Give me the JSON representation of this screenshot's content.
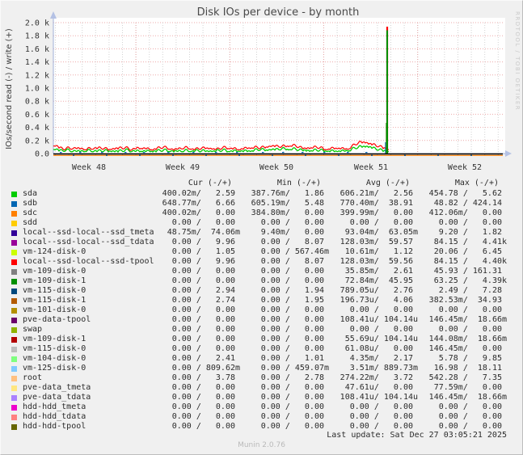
{
  "title": "Disk IOs per device - by month",
  "watermark": "RRDTOOL / TOBI OETIKER",
  "footer": {
    "last_update": "Last update: Sat Dec 27 03:05:21 2025",
    "munin_version": "Munin 2.0.76"
  },
  "legend": {
    "headers": [
      "Cur (-/+)",
      "Min (-/+)",
      "Avg (-/+)",
      "Max (-/+)"
    ]
  },
  "chart_data": {
    "type": "line",
    "title": "Disk IOs per device - by month",
    "ylabel": "IOs/second read (-) / write (+)",
    "xlabel": "",
    "grid": true,
    "legend_position": "bottom-table",
    "ylim": [
      0,
      2000
    ],
    "y_ticks": [
      "2.0 k",
      "1.8 k",
      "1.6 k",
      "1.4 k",
      "1.2 k",
      "1.0 k",
      "0.8 k",
      "0.6 k",
      "0.4 k",
      "0.2 k",
      "0.0"
    ],
    "x_ticks": [
      "Week 48",
      "Week 49",
      "Week 50",
      "Week 51",
      "Week 52"
    ],
    "visible_features": {
      "baseline_band": "all active devices fluctuate between 0 and ~80 write IOs/s across Weeks 48-51",
      "spike": {
        "x_label": "just after Week 51",
        "peak_write_ios": 1900,
        "colors_top_to_bottom": [
          "#FF0000",
          "#008F00"
        ]
      },
      "after_spike": "flat at ~0 until right edge (Week 52+)",
      "negative_read_line": "thin orange line just below zero across full width"
    },
    "series": [
      {
        "label": "sda",
        "color": "#00CC00",
        "cur": "400.02m/   2.59 ",
        "min": "387.76m/   1.86 ",
        "avg": "606.21m/   2.56 ",
        "max": "454.78 /   5.62 "
      },
      {
        "label": "sdb",
        "color": "#0066B3",
        "cur": "648.77m/   6.66 ",
        "min": "605.19m/   5.48 ",
        "avg": "770.40m/  38.91 ",
        "max": " 48.82 / 424.14 "
      },
      {
        "label": "sdc",
        "color": "#FF8000",
        "cur": "400.02m/   0.00 ",
        "min": "384.80m/   0.00 ",
        "avg": "399.99m/   0.00 ",
        "max": "412.06m/   0.00 "
      },
      {
        "label": "sdd",
        "color": "#FFCC00",
        "cur": "  0.00 /   0.00 ",
        "min": "  0.00 /   0.00 ",
        "avg": "  0.00 /   0.00 ",
        "max": "  0.00 /   0.00 "
      },
      {
        "label": "local--ssd-local--ssd_tmeta",
        "color": "#330099",
        "cur": " 48.75m/  74.06m",
        "min": "  9.40m/   0.00 ",
        "avg": " 93.04m/  63.05m",
        "max": "  9.20 /   1.82 "
      },
      {
        "label": "local--ssd-local--ssd_tdata",
        "color": "#990099",
        "cur": "  0.00 /   9.96 ",
        "min": "  0.00 /   8.07 ",
        "avg": "128.03m/  59.57 ",
        "max": " 84.15 /   4.41k"
      },
      {
        "label": "vm-124-disk-0",
        "color": "#CCFF00",
        "cur": "  0.00 /   1.05 ",
        "min": "  0.00 / 567.46m",
        "avg": " 10.61m/   1.12 ",
        "max": " 20.06 /   6.45 "
      },
      {
        "label": "local--ssd-local--ssd-tpool",
        "color": "#FF0000",
        "cur": "  0.00 /   9.96 ",
        "min": "  0.00 /   8.07 ",
        "avg": "128.03m/  59.56 ",
        "max": " 84.15 /   4.40k"
      },
      {
        "label": "vm-109-disk-0",
        "color": "#808080",
        "cur": "  0.00 /   0.00 ",
        "min": "  0.00 /   0.00 ",
        "avg": " 35.85m/   2.61 ",
        "max": " 45.93 / 161.31 "
      },
      {
        "label": "vm-109-disk-1",
        "color": "#008F00",
        "cur": "  0.00 /   0.00 ",
        "min": "  0.00 /   0.00 ",
        "avg": " 72.84m/  45.95 ",
        "max": " 63.25 /   4.39k"
      },
      {
        "label": "vm-115-disk-0",
        "color": "#00487D",
        "cur": "  0.00 /   2.94 ",
        "min": "  0.00 /   1.94 ",
        "avg": "789.05u/   2.76 ",
        "max": "  2.49 /   7.28 "
      },
      {
        "label": "vm-115-disk-1",
        "color": "#B35A00",
        "cur": "  0.00 /   2.74 ",
        "min": "  0.00 /   1.95 ",
        "avg": "196.73u/   4.06 ",
        "max": "382.53m/  34.93 "
      },
      {
        "label": "vm-101-disk-0",
        "color": "#B38F00",
        "cur": "  0.00 /   0.00 ",
        "min": "  0.00 /   0.00 ",
        "avg": "  0.00 /   0.00 ",
        "max": "  0.00 /   0.00 "
      },
      {
        "label": "pve-data-tpool",
        "color": "#6B006B",
        "cur": "  0.00 /   0.00 ",
        "min": "  0.00 /   0.00 ",
        "avg": "108.41u/ 104.14u",
        "max": "146.45m/  18.66m"
      },
      {
        "label": "swap",
        "color": "#8FB300",
        "cur": "  0.00 /   0.00 ",
        "min": "  0.00 /   0.00 ",
        "avg": "  0.00 /   0.00 ",
        "max": "  0.00 /   0.00 "
      },
      {
        "label": "vm-109-disk-1",
        "color": "#B30000",
        "cur": "  0.00 /   0.00 ",
        "min": "  0.00 /   0.00 ",
        "avg": " 55.69u/ 104.14u",
        "max": "144.08m/  18.66m"
      },
      {
        "label": "vm-115-disk-0",
        "color": "#BEBEBE",
        "cur": "  0.00 /   0.00 ",
        "min": "  0.00 /   0.00 ",
        "avg": " 61.08u/   0.00 ",
        "max": "146.45m/   0.00 "
      },
      {
        "label": "vm-104-disk-0",
        "color": "#80FF80",
        "cur": "  0.00 /   2.41 ",
        "min": "  0.00 /   1.01 ",
        "avg": "  4.35m/   2.17 ",
        "max": "  5.78 /   9.85 "
      },
      {
        "label": "vm-125-disk-0",
        "color": "#80C9FF",
        "cur": "  0.00 / 809.62m",
        "min": "  0.00 / 459.07m",
        "avg": "  3.51m/ 889.73m",
        "max": " 16.98 /  18.11 "
      },
      {
        "label": "root",
        "color": "#FFC080",
        "cur": "  0.00 /   3.78 ",
        "min": "  0.00 /   2.78 ",
        "avg": "274.22m/   3.72 ",
        "max": "542.28 /   7.35 "
      },
      {
        "label": "pve-data_tmeta",
        "color": "#FFE680",
        "cur": "  0.00 /   0.00 ",
        "min": "  0.00 /   0.00 ",
        "avg": " 47.61u/   0.00 ",
        "max": " 77.59m/   0.00 "
      },
      {
        "label": "pve-data_tdata",
        "color": "#AA80FF",
        "cur": "  0.00 /   0.00 ",
        "min": "  0.00 /   0.00 ",
        "avg": "108.41u/ 104.14u",
        "max": "146.45m/  18.66m"
      },
      {
        "label": "hdd-hdd_tmeta",
        "color": "#EE00CC",
        "cur": "  0.00 /   0.00 ",
        "min": "  0.00 /   0.00 ",
        "avg": "  0.00 /   0.00 ",
        "max": "  0.00 /   0.00 "
      },
      {
        "label": "hdd-hdd_tdata",
        "color": "#FF8080",
        "cur": "  0.00 /   0.00 ",
        "min": "  0.00 /   0.00 ",
        "avg": "  0.00 /   0.00 ",
        "max": "  0.00 /   0.00 "
      },
      {
        "label": "hdd-hdd-tpool",
        "color": "#666600",
        "cur": "  0.00 /   0.00 ",
        "min": "  0.00 /   0.00 ",
        "avg": "  0.00 /   0.00 ",
        "max": "  0.00 /   0.00 "
      }
    ]
  }
}
